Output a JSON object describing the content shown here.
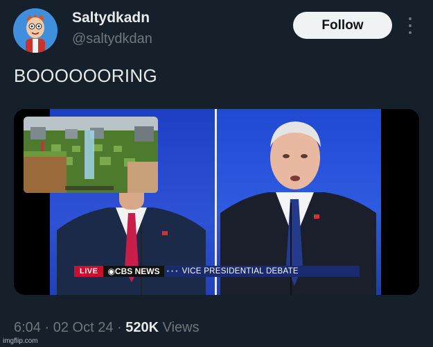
{
  "author": {
    "display_name": "Saltydkadn",
    "handle": "@saltydkdan"
  },
  "follow_button": "Follow",
  "tweet": {
    "text": "BOOOOOORING"
  },
  "video": {
    "live_label": "LIVE",
    "network_label": "◉CBS NEWS",
    "separator": "• • •",
    "headline": "VICE PRESIDENTIAL DEBATE"
  },
  "meta": {
    "time": "6:04",
    "date": "02 Oct 24",
    "views_count": "520K",
    "views_label": "Views"
  },
  "watermark": "imgflip.com",
  "colors": {
    "background": "#15202b",
    "primary_text": "#e7e9ea",
    "secondary_text": "#71767b",
    "follow_bg": "#eff3f4",
    "debate_blue": "#2a4fd4",
    "live_red": "#c8102e"
  }
}
